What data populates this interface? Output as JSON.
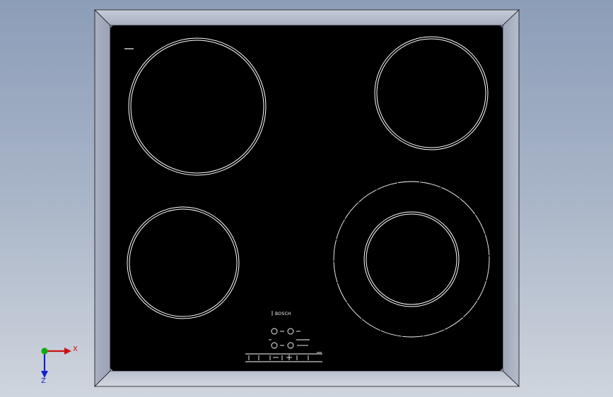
{
  "model": {
    "name": "cooktop",
    "brand": "BOSCH",
    "zones": [
      "rear-left",
      "rear-right",
      "front-left",
      "front-right-dual"
    ]
  },
  "controls": {
    "knobs": 4,
    "buttons": 6,
    "plus_symbol": "+"
  },
  "triad": {
    "x_label": "X",
    "z_label": "Z",
    "x_color": "#cc1111",
    "y_color": "#11aa11",
    "z_color": "#1122cc"
  },
  "colors": {
    "background_top": "#8c9db8",
    "background_bottom": "#cfd5dd",
    "frame": "#aeb4c4",
    "glass": "#000000",
    "ring": "#ffffff"
  }
}
